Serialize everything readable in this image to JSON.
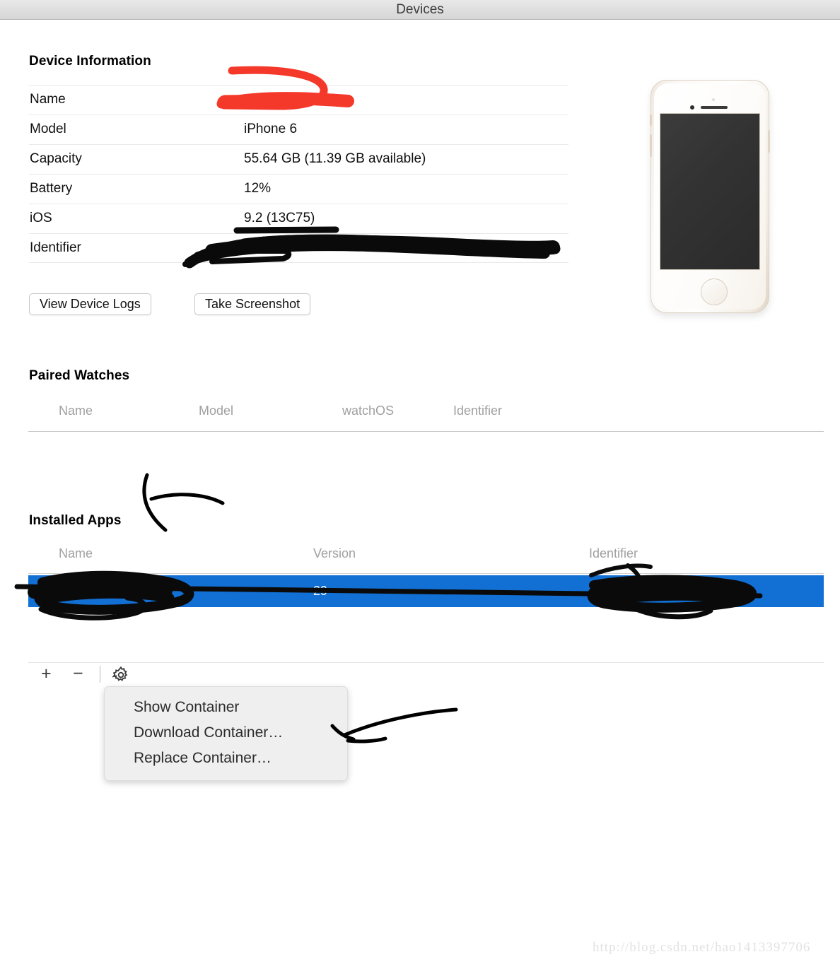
{
  "window": {
    "title": "Devices"
  },
  "device_information": {
    "heading": "Device Information",
    "rows": [
      {
        "label": "Name",
        "value": "",
        "redacted": true
      },
      {
        "label": "Model",
        "value": "iPhone 6",
        "redacted": false
      },
      {
        "label": "Capacity",
        "value": "55.64 GB (11.39 GB available)",
        "redacted": false
      },
      {
        "label": "Battery",
        "value": "12%",
        "redacted": false
      },
      {
        "label": "iOS",
        "value": "9.2 (13C75)",
        "redacted": false
      },
      {
        "label": "Identifier",
        "value": "…",
        "redacted": true
      }
    ],
    "buttons": {
      "view_device_logs": "View Device Logs",
      "take_screenshot": "Take Screenshot"
    },
    "device_image": "iphone-6-gold-illustration"
  },
  "paired_watches": {
    "heading": "Paired Watches",
    "columns": [
      "Name",
      "Model",
      "watchOS",
      "Identifier"
    ],
    "rows": []
  },
  "installed_apps": {
    "heading": "Installed Apps",
    "columns": [
      "Name",
      "Version",
      "Identifier"
    ],
    "rows": [
      {
        "name": "",
        "version": "29",
        "identifier": "",
        "selected": true,
        "redacted": true
      }
    ]
  },
  "toolbar": {
    "add_label": "+",
    "remove_label": "−",
    "settings_icon": "gear-icon"
  },
  "context_menu": {
    "items": [
      "Show Container",
      "Download Container…",
      "Replace Container…"
    ]
  },
  "watermark": {
    "text": "http://blog.csdn.net/hao1413397706"
  },
  "colors": {
    "selection_blue": "#1270d4",
    "redaction_red": "#f4392b",
    "redaction_black": "#0a0a0a",
    "titlebar_top": "#e8e8e8",
    "titlebar_bottom": "#d6d6d6",
    "menu_background": "#efefef",
    "column_header_text": "#a0a0a0"
  }
}
